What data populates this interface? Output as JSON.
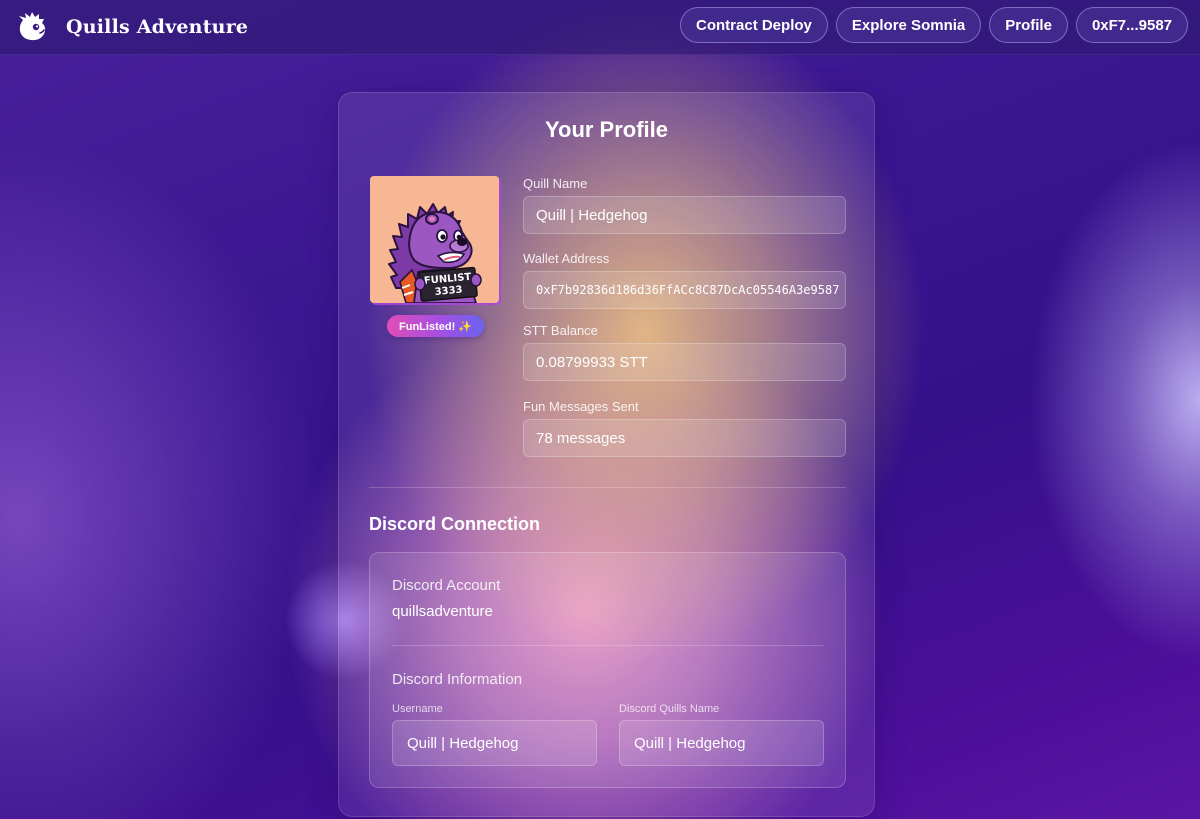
{
  "app": {
    "name": "Quills Adventure",
    "logo_icon": "quill-hedgehog-logo-icon"
  },
  "nav": {
    "items": [
      {
        "label": "Contract Deploy"
      },
      {
        "label": "Explore Somnia"
      },
      {
        "label": "Profile"
      },
      {
        "label": "0xF7...9587"
      }
    ]
  },
  "profile": {
    "title": "Your Profile",
    "avatar": {
      "icon": "hedgehog-avatar-icon",
      "sign_line1": "FUNLIST",
      "sign_line2": "3333"
    },
    "badge": "FunListed! ✨",
    "fields": {
      "quill_name": {
        "label": "Quill Name",
        "value": "Quill | Hedgehog"
      },
      "wallet_address": {
        "label": "Wallet Address",
        "value": "0xF7b92836d186d36FfACc8C87DcAc05546A3e9587"
      },
      "stt_balance": {
        "label": "STT Balance",
        "value": "0.08799933 STT"
      },
      "fun_messages": {
        "label": "Fun Messages Sent",
        "value": "78 messages"
      }
    }
  },
  "discord": {
    "section_title": "Discord Connection",
    "account_label": "Discord Account",
    "account_value": "quillsadventure",
    "info_label": "Discord Information",
    "username_label": "Username",
    "username_value": "Quill | Hedgehog",
    "quills_name_label": "Discord Quills Name",
    "quills_name_value": "Quill | Hedgehog"
  },
  "colors": {
    "background_primary": "#3a1691",
    "badge_gradient_start": "#e04eb6",
    "badge_gradient_end": "#6a63ef",
    "avatar_background": "#f7b694"
  }
}
